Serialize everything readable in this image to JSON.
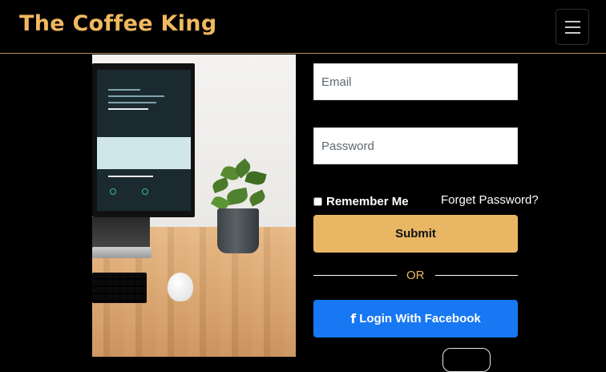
{
  "navbar": {
    "brand": "The Coffee King",
    "menu_icon": "hamburger-menu-icon"
  },
  "hero": {
    "image_alt": "workspace-photo"
  },
  "login_form": {
    "email_placeholder": "Email",
    "password_placeholder": "Password",
    "remember_me_label": "Remember Me",
    "remember_me_checked": false,
    "forgot_password_label": "Forget Password?",
    "submit_label": "Submit",
    "divider_text": "OR",
    "facebook_icon": "facebook-icon",
    "facebook_glyph": "f",
    "facebook_label": "Login With Facebook"
  },
  "colors": {
    "background": "#000000",
    "brand": "#f0b860",
    "accent_button": "#e9b764",
    "facebook_blue": "#1877f2"
  }
}
